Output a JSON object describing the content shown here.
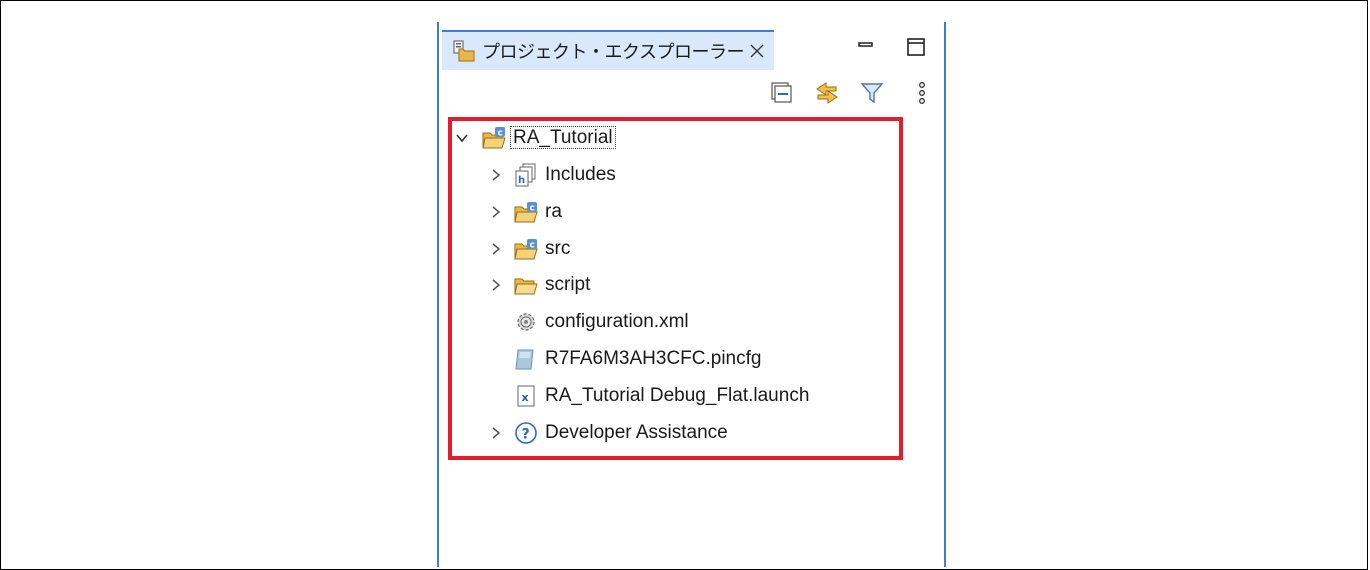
{
  "window": {
    "tab_title": "プロジェクト・エクスプローラー",
    "tab_icon": "project-explorer-icon",
    "close_icon": "close-icon",
    "minimize_icon": "minimize-icon",
    "maximize_icon": "maximize-icon"
  },
  "toolbar": {
    "items": [
      {
        "icon": "collapse-all-icon"
      },
      {
        "icon": "link-with-editor-icon"
      },
      {
        "icon": "filter-icon"
      },
      {
        "icon": "view-menu-icon"
      }
    ]
  },
  "tree": {
    "root": {
      "label": "RA_Tutorial",
      "icon": "c-project-folder-icon",
      "expanded": true
    },
    "items": [
      {
        "label": "Includes",
        "icon": "includes-icon",
        "expandable": true
      },
      {
        "label": "ra",
        "icon": "source-folder-icon",
        "expandable": true
      },
      {
        "label": "src",
        "icon": "source-folder-icon",
        "expandable": true
      },
      {
        "label": "script",
        "icon": "folder-icon",
        "expandable": true
      },
      {
        "label": "configuration.xml",
        "icon": "gear-file-icon",
        "expandable": false
      },
      {
        "label": "R7FA6M3AH3CFC.pincfg",
        "icon": "pincfg-file-icon",
        "expandable": false
      },
      {
        "label": "RA_Tutorial Debug_Flat.launch",
        "icon": "launch-file-icon",
        "expandable": false
      },
      {
        "label": "Developer Assistance",
        "icon": "help-icon",
        "expandable": true
      }
    ]
  },
  "colors": {
    "accent": "#3c7fd1",
    "tab_bg": "#dae8fc",
    "highlight_box": "#e31e2a"
  }
}
